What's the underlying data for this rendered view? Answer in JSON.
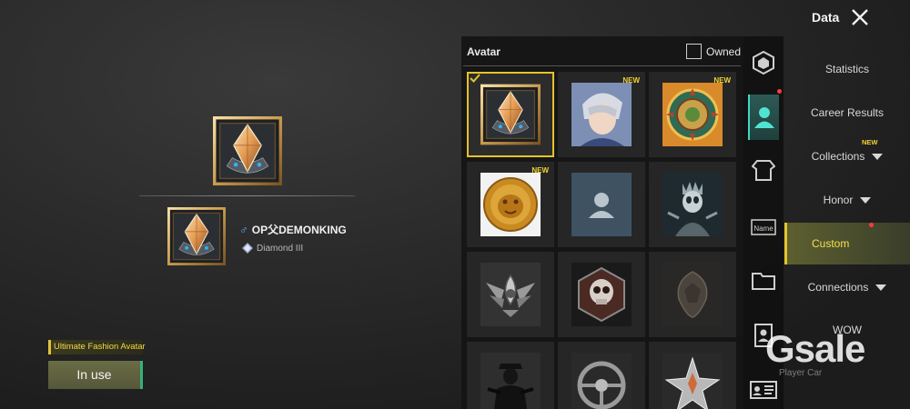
{
  "header": {
    "title": "Data"
  },
  "preview": {
    "player_name": "OP父DEMONKING",
    "rank": "Diamond III",
    "fashion_label": "Ultimate Fashion Avatar",
    "status_button": "In use"
  },
  "avatar_panel": {
    "title": "Avatar",
    "owned_label": "Owned",
    "new_badge": "NEW",
    "items": [
      {
        "name": "diamond-badge-avatar",
        "new": false,
        "selected": true
      },
      {
        "name": "silver-hair-character-avatar",
        "new": true,
        "selected": false
      },
      {
        "name": "ornate-medallion-avatar",
        "new": true,
        "selected": false
      },
      {
        "name": "golden-lion-coin-avatar",
        "new": true,
        "selected": false
      },
      {
        "name": "default-user-avatar",
        "new": false,
        "selected": false
      },
      {
        "name": "skeleton-king-avatar",
        "new": false,
        "selected": false
      },
      {
        "name": "winged-emblem-avatar",
        "new": false,
        "selected": false
      },
      {
        "name": "skull-emblem-avatar",
        "new": false,
        "selected": false
      },
      {
        "name": "dark-crest-avatar",
        "new": false,
        "selected": false
      },
      {
        "name": "soldier-silhouette-avatar",
        "new": false,
        "selected": false
      },
      {
        "name": "steering-wheel-avatar",
        "new": false,
        "selected": false
      },
      {
        "name": "silver-star-avatar",
        "new": false,
        "selected": false
      }
    ]
  },
  "tabs": [
    {
      "name": "badge-tab-icon",
      "active": false
    },
    {
      "name": "avatar-tab-icon",
      "active": true,
      "dot": true
    },
    {
      "name": "outfit-tab-icon",
      "active": false
    },
    {
      "name": "nameplate-tab-icon",
      "active": false
    },
    {
      "name": "folder-tab-icon",
      "active": false
    },
    {
      "name": "id-card-tab-icon",
      "active": false
    },
    {
      "name": "player-card-tab-icon",
      "active": false
    }
  ],
  "menu": {
    "items": [
      {
        "label": "Statistics",
        "caret": false,
        "new": false,
        "active": false
      },
      {
        "label": "Career Results",
        "caret": false,
        "new": false,
        "active": false
      },
      {
        "label": "Collections",
        "caret": true,
        "new": true,
        "active": false
      },
      {
        "label": "Honor",
        "caret": true,
        "new": false,
        "active": false
      },
      {
        "label": "Custom",
        "caret": false,
        "new": false,
        "active": true,
        "dot": true
      },
      {
        "label": "Connections",
        "caret": true,
        "new": false,
        "active": false
      },
      {
        "label": "WOW",
        "caret": false,
        "new": false,
        "active": false
      }
    ],
    "footer_partial": "Player Car"
  },
  "watermark": {
    "text": "Gsale"
  },
  "colors": {
    "accent_gold": "#e3c42a",
    "accent_teal": "#43d6c6",
    "notification_red": "#ff3b3b"
  }
}
